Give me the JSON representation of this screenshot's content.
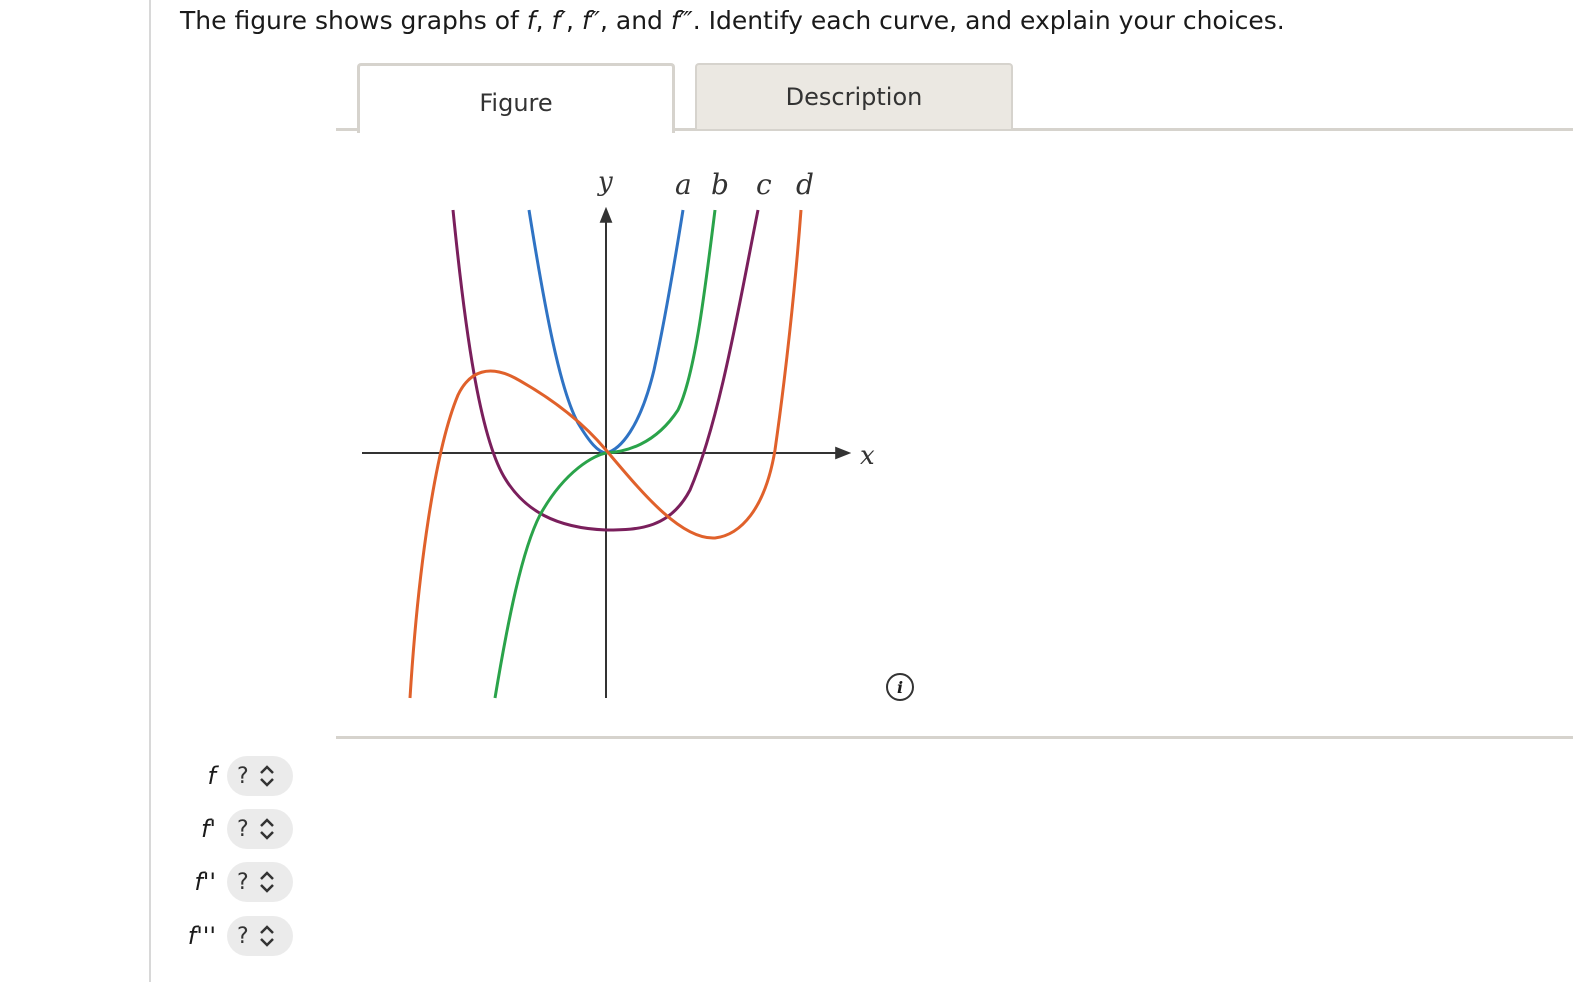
{
  "question": {
    "prefix": "The figure shows graphs of ",
    "f": "f",
    "sep1": ", ",
    "f1": "f′",
    "sep2": ", ",
    "f2": "f″",
    "sep3": ", and ",
    "f3": "f‴",
    "suffix": ". Identify each curve, and explain your choices."
  },
  "tabs": {
    "figure": "Figure",
    "description": "Description"
  },
  "graph": {
    "y_label": "y",
    "x_label": "x",
    "curve_labels": {
      "a": "a",
      "b": "b",
      "c": "c",
      "d": "d"
    },
    "colors": {
      "a": "#2f73c4",
      "b": "#2aa34a",
      "c": "#7a1f5c",
      "d": "#e0612b",
      "axis": "#333333"
    }
  },
  "info_icon": "i",
  "answers": [
    {
      "label": "f",
      "value": "?"
    },
    {
      "label": "f'",
      "value": "?"
    },
    {
      "label": "f''",
      "value": "?"
    },
    {
      "label": "f'''",
      "value": "?"
    }
  ]
}
